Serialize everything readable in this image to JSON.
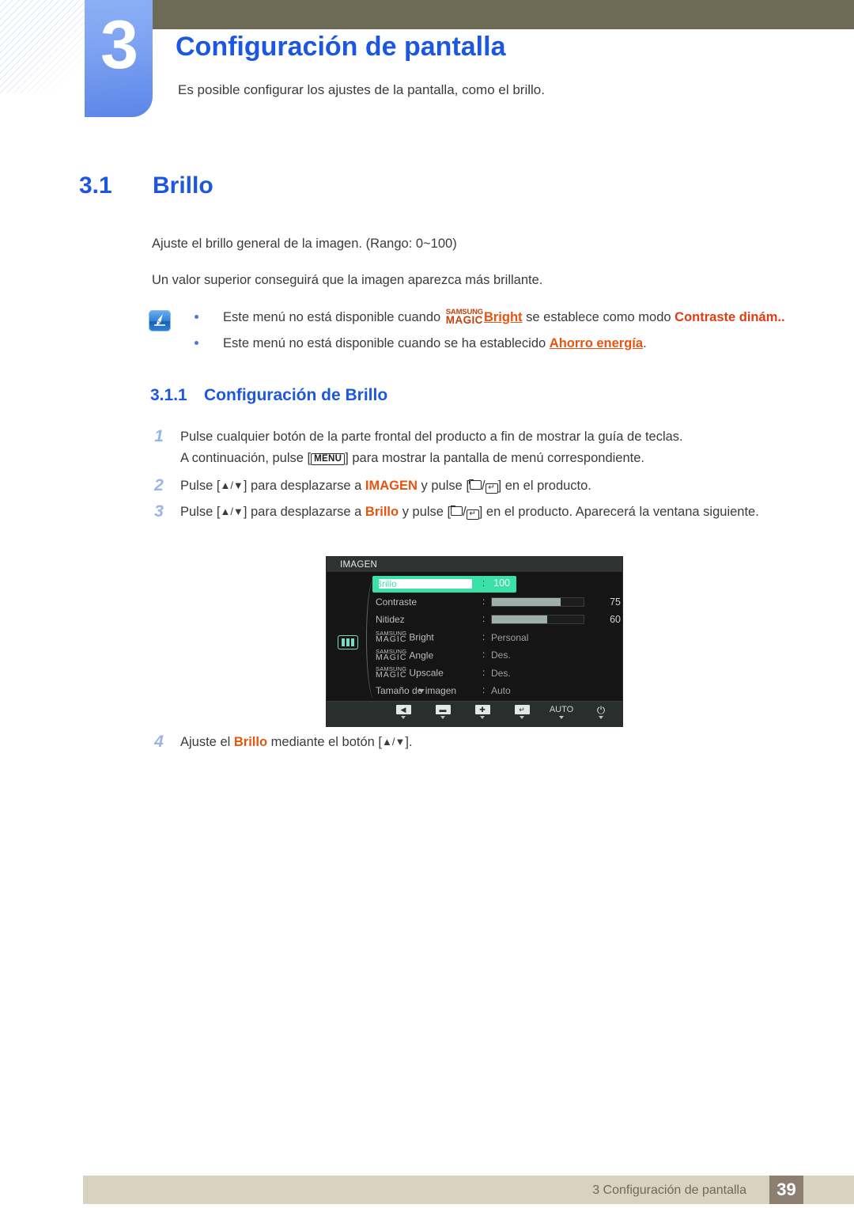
{
  "chapter": {
    "number": "3",
    "title": "Configuración de pantalla",
    "subtitle": "Es posible configurar los ajustes de la pantalla, como el brillo."
  },
  "section": {
    "number": "3.1",
    "title": "Brillo",
    "paragraph_1": "Ajuste el brillo general de la imagen. (Rango: 0~100)",
    "paragraph_2": "Un valor superior conseguirá que la imagen aparezca más brillante."
  },
  "note": {
    "icon": "note-pen-icon",
    "line1_before": "Este menú no está disponible cuando",
    "magic_top": "SAMSUNG",
    "magic_bottom": "MAGIC",
    "line1_bright": "Bright",
    "line1_mid": "se establece como modo",
    "line1_mode": "Contraste dinám..",
    "line2_before": "Este menú no está disponible cuando se ha establecido",
    "line2_link": "Ahorro energía",
    "line2_after": "."
  },
  "subsection": {
    "number": "3.1.1",
    "title": "Configuración de Brillo"
  },
  "steps": {
    "s1_idx": "1",
    "s1_a": "Pulse cualquier botón de la parte frontal del producto a fin de mostrar la guía de teclas.",
    "s1_b_before": "A continuación, pulse [",
    "s1_menu_key": "MENU",
    "s1_b_after": "] para mostrar la pantalla de menú correspondiente.",
    "s2_idx": "2",
    "s2_a": "Pulse [",
    "s2_updown": "▲/▼",
    "s2_b": "] para desplazarse a",
    "s2_target": "IMAGEN",
    "s2_c": "y pulse [",
    "s2_d": "] en el producto.",
    "s3_idx": "3",
    "s3_a": "Pulse [",
    "s3_updown": "▲/▼",
    "s3_b": "] para desplazarse a",
    "s3_target": "Brillo",
    "s3_c": "y pulse [",
    "s3_d": "] en el producto. Aparecerá la ventana siguiente.",
    "s4_idx": "4",
    "s4_a": "Ajuste el",
    "s4_target": "Brillo",
    "s4_b": "mediante el botón [",
    "s4_updown": "▲/▼",
    "s4_c": "]."
  },
  "osd": {
    "title": "IMAGEN",
    "category_icon": "picture-icon",
    "rows": [
      {
        "label": "Brillo",
        "type": "slider",
        "value": 100,
        "display": "100",
        "selected": true
      },
      {
        "label": "Contraste",
        "type": "slider",
        "value": 75,
        "display": "75",
        "selected": false
      },
      {
        "label": "Nitidez",
        "type": "slider",
        "value": 60,
        "display": "60",
        "selected": false
      },
      {
        "label": "Bright",
        "type": "magic",
        "display": "Personal",
        "selected": false
      },
      {
        "label": "Angle",
        "type": "magic",
        "display": "Des.",
        "selected": false
      },
      {
        "label": "Upscale",
        "type": "magic",
        "display": "Des.",
        "selected": false
      },
      {
        "label": "Tamaño de imagen",
        "type": "text",
        "display": "Auto",
        "selected": false
      }
    ],
    "magic_top": "SAMSUNG",
    "magic_bottom": "MAGIC",
    "colon": ":",
    "scroll_more_icon": "chevron-down-icon",
    "footer_buttons": [
      {
        "icon": "back-arrow-icon",
        "label": "◀"
      },
      {
        "icon": "minus-icon",
        "label": "▬"
      },
      {
        "icon": "plus-icon",
        "label": "✚"
      },
      {
        "icon": "enter-icon",
        "label": "↵"
      },
      {
        "icon": "auto-label",
        "label": "AUTO"
      },
      {
        "icon": "power-icon",
        "label": "⏻"
      }
    ]
  },
  "footer": {
    "text": "3 Configuración de pantalla",
    "page": "39"
  },
  "colors": {
    "heading_blue": "#1b57e0",
    "tab_blue": "#7ea3f2",
    "header_olive": "#6d6a55",
    "footer_beige": "#d9d2c0",
    "footer_page_brown": "#8c7f72",
    "accent_orange": "#e8530e",
    "osd_highlight_green": "#39e0a8"
  }
}
